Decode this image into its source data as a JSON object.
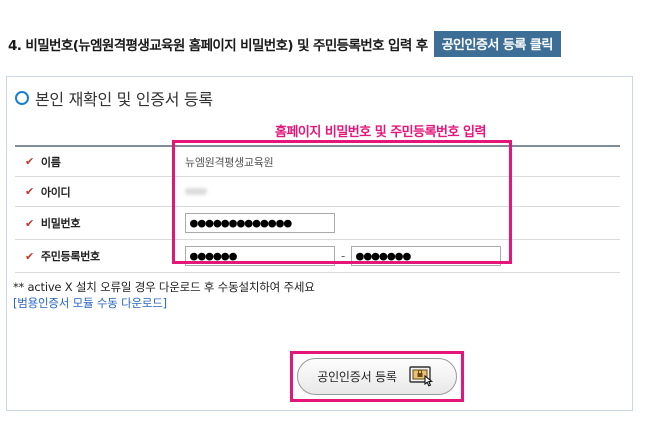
{
  "step": {
    "title": "4.  비밀번호(뉴엠원격평생교육원 홈페이지 비밀번호) 및 주민등록번호 입력 후",
    "badge": "공인인증서 등록 클릭"
  },
  "panel": {
    "heading": "본인 재확인 및 인증서 등록",
    "highlight_label": "홈페이지 비밀번호 및 주민등록번호 입력"
  },
  "form": {
    "name_label": "이름",
    "name_value": "뉴엠원격평생교육원",
    "id_label": "아이디",
    "password_label": "비밀번호",
    "password_value": "●●●●●●●●●●●●●",
    "ssn_label": "주민등록번호",
    "ssn_front": "●●●●●●",
    "ssn_separator": "-",
    "ssn_back": "●●●●●●●"
  },
  "notice": {
    "text": "** active X 설치 오류일 경우 다운로드 후 수동설치하여 주세요",
    "link": "[범용인증서 모듈 수동 다운로드]"
  },
  "button": {
    "label": "공인인증서 등록"
  },
  "colors": {
    "highlight": "#e4167a",
    "badge_bg": "#3d6f96",
    "accent": "#1b7fd0",
    "link": "#2a66c4"
  }
}
